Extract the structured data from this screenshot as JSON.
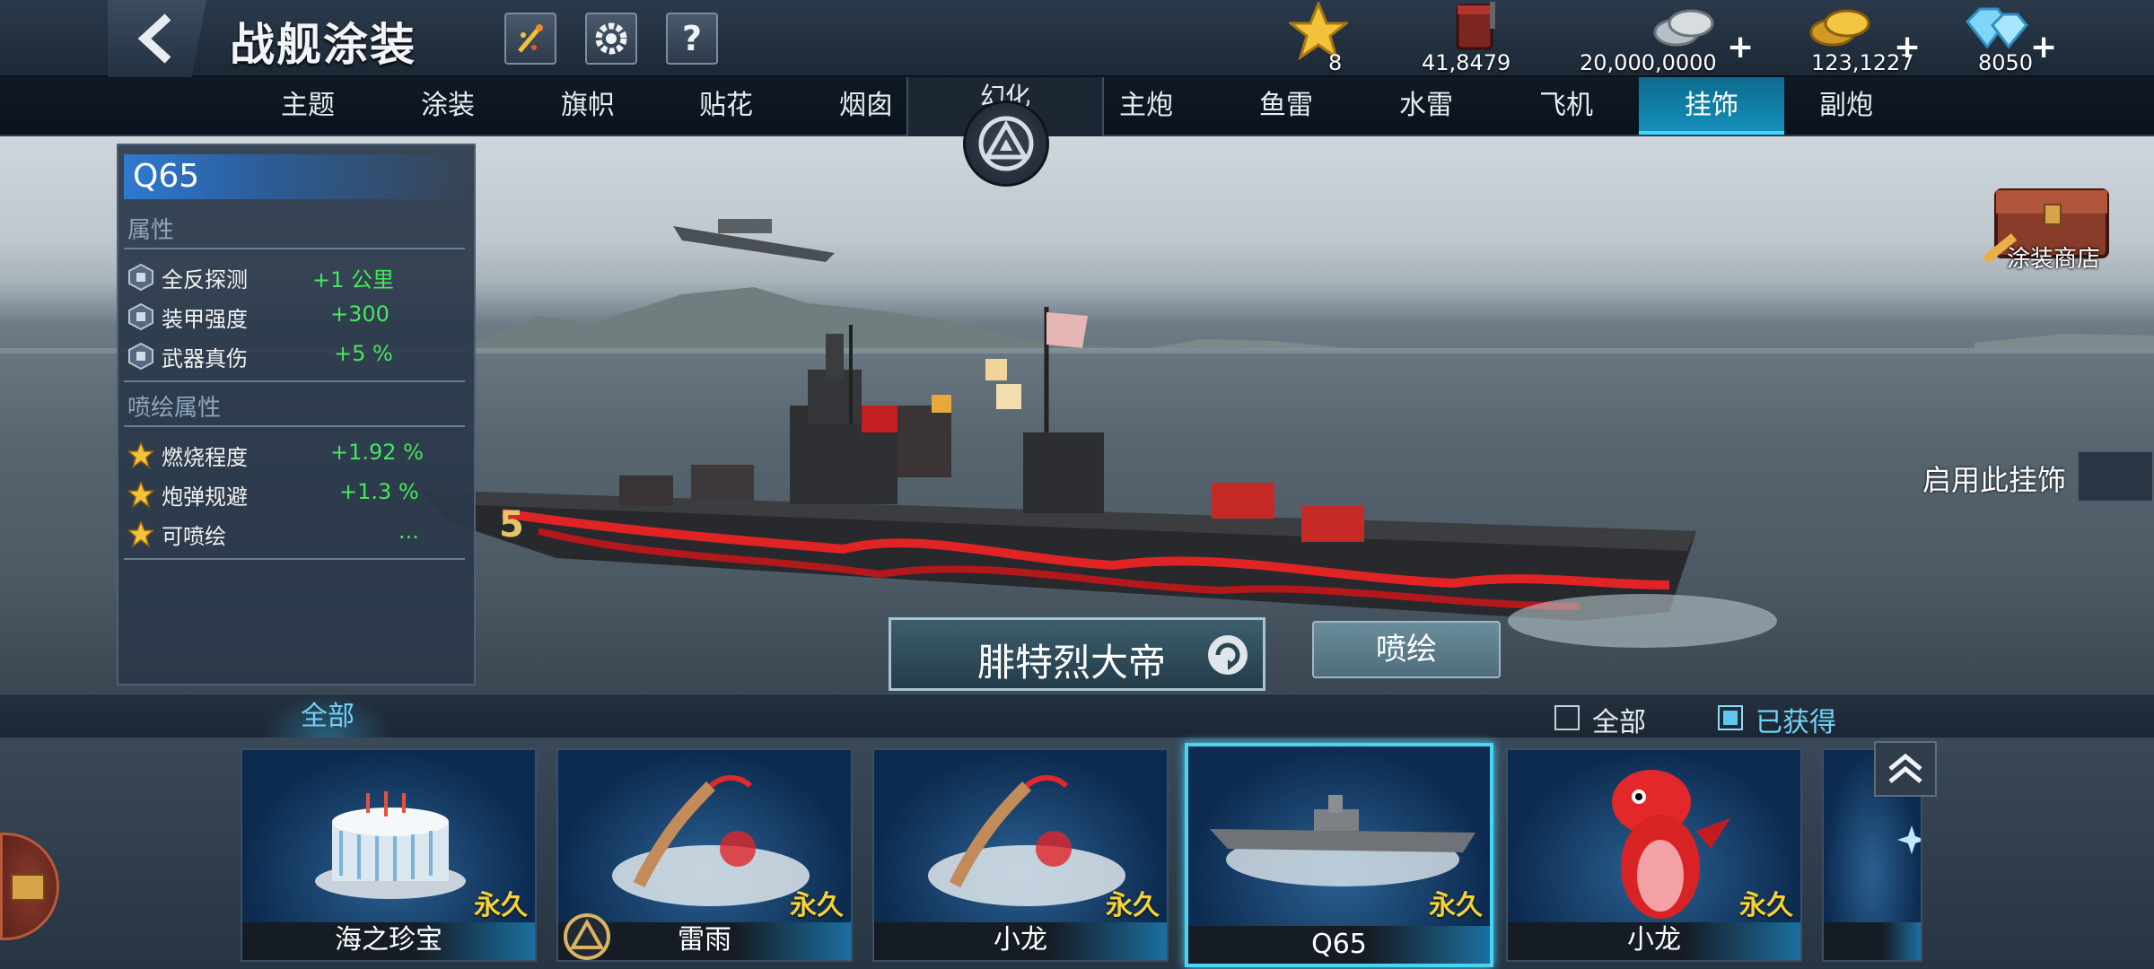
{
  "header": {
    "title": "战舰涂装",
    "icons": [
      "back-arrow-icon",
      "fireworks-icon",
      "gear-icon",
      "help-icon"
    ],
    "help_label": "?"
  },
  "currencies": [
    {
      "name": "star",
      "value": "8",
      "plus": false,
      "color": "#f2c23a"
    },
    {
      "name": "paint-bucket",
      "value": "41,8479",
      "plus": false,
      "color": "#8a2a22"
    },
    {
      "name": "silver-coins",
      "value": "20,000,0000",
      "plus": true,
      "color": "#c9ced4"
    },
    {
      "name": "gold-coins",
      "value": "123,1227",
      "plus": true,
      "color": "#f0b530"
    },
    {
      "name": "diamonds",
      "value": "8050",
      "plus": true,
      "color": "#69c8f2"
    }
  ],
  "tabs_left": [
    "主题",
    "涂装",
    "旗帜",
    "贴花",
    "烟囱"
  ],
  "tab_center": "幻化",
  "tabs_right": [
    "主炮",
    "鱼雷",
    "水雷",
    "飞机",
    "挂饰",
    "副炮"
  ],
  "active_tab": "挂饰",
  "attributes": {
    "item_name": "Q65",
    "section1": "属性",
    "rows1": [
      {
        "label": "全反探测",
        "value": "+1 公里"
      },
      {
        "label": "装甲强度",
        "value": "+300"
      },
      {
        "label": "武器真伤",
        "value": "+5 %"
      }
    ],
    "section2": "喷绘属性",
    "rows2": [
      {
        "label": "燃烧程度",
        "value": "+1.92 %"
      },
      {
        "label": "炮弹规避",
        "value": "+1.3 %"
      },
      {
        "label": "可喷绘",
        "value": "..."
      }
    ]
  },
  "scene": {
    "ship_name": "腓特烈大帝",
    "paint_button": "喷绘",
    "shop_label": "涂装商店",
    "enable_label": "启用此挂饰",
    "hull_number": "5"
  },
  "filter": {
    "category": "全部",
    "all_label": "全部",
    "owned_label": "已获得",
    "owned_checked": true
  },
  "items": [
    {
      "name": "海之珍宝",
      "duration": "永久",
      "art": "cake"
    },
    {
      "name": "雷雨",
      "duration": "永久",
      "art": "dragon-boat",
      "badge": "huanhua-icon"
    },
    {
      "name": "小龙",
      "duration": "永久",
      "art": "dragon-boat"
    },
    {
      "name": "Q65",
      "duration": "永久",
      "art": "warship",
      "selected": true
    },
    {
      "name": "小龙",
      "duration": "永久",
      "art": "red-dragon"
    }
  ]
}
